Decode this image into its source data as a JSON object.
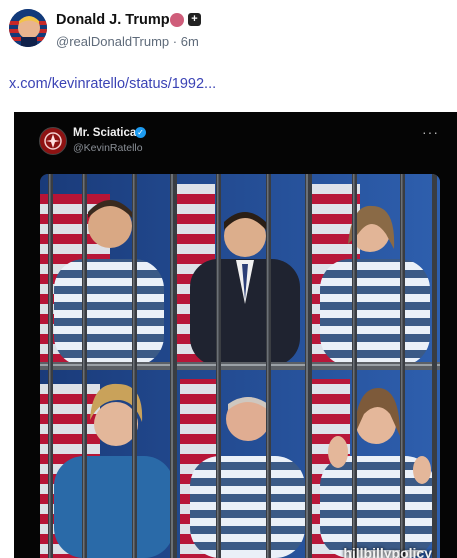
{
  "post": {
    "author_name": "Donald J. Trump",
    "handle": "@realDonaldTrump",
    "separator": "·",
    "time": "6m",
    "plus_symbol": "+",
    "link_text": "x.com/kevinratello/status/1992..."
  },
  "embed": {
    "author_name": "Mr. Sciatica",
    "handle": "@KevinRatello",
    "menu_glyph": "···",
    "verified_glyph": "✓",
    "watermark": "hillbillypolicy"
  },
  "colors": {
    "link": "#3b43b5",
    "verified_pink": "#cf5d7a",
    "verified_blue": "#1d9bf0",
    "embed_bg": "#050505"
  },
  "icons": {
    "avatar": "flag-portrait-avatar",
    "verified": "verified-badge-icon",
    "plus": "plus-badge-icon",
    "embed_avatar": "red-emblem-avatar",
    "menu": "more-options-icon"
  }
}
